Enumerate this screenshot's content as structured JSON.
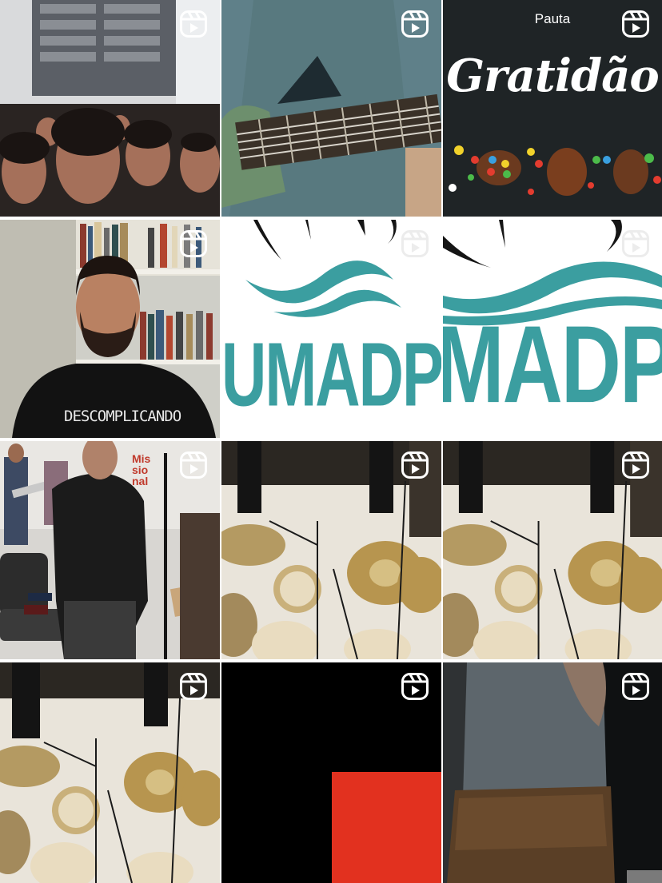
{
  "colors": {
    "teal": "#3b9ea0",
    "red_block": "#e2311f",
    "chalkboard": "#1f2426",
    "black": "#000000"
  },
  "reel_icon_name": "reels-icon",
  "tiles": [
    {
      "kind": "video",
      "subject": "audience"
    },
    {
      "kind": "video",
      "subject": "guitar-closeup"
    },
    {
      "kind": "video",
      "subject": "easter-chalkboard",
      "brand": "Pauta",
      "title": "Gratidão"
    },
    {
      "kind": "video",
      "subject": "presenter",
      "shirt_text": "DESCOMPLICANDO"
    },
    {
      "kind": "video",
      "subject": "logo",
      "logo_text": "UMADPH"
    },
    {
      "kind": "video",
      "subject": "logo-zoomed",
      "logo_text": "MADPH"
    },
    {
      "kind": "video",
      "subject": "band-rehearsal",
      "sign_text": "Mis sio nal"
    },
    {
      "kind": "video",
      "subject": "drum-kit"
    },
    {
      "kind": "video",
      "subject": "drum-kit"
    },
    {
      "kind": "video",
      "subject": "drum-kit"
    },
    {
      "kind": "video",
      "subject": "red-block-on-black"
    },
    {
      "kind": "video",
      "subject": "drummer-dark"
    }
  ]
}
